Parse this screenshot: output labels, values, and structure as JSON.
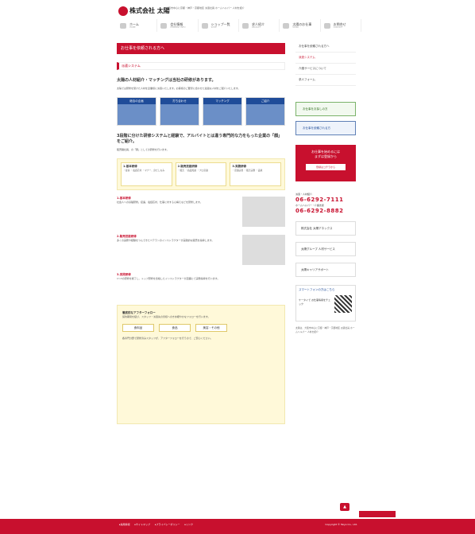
{
  "header": {
    "company": "株式会社 太陽",
    "tagline": "大阪市中心に京都・神戸・京都地区 派遣社員 ホームヘルパー 人材を紹介"
  },
  "nav": [
    {
      "jp": "ホーム",
      "en": "HOME"
    },
    {
      "jp": "会社情報",
      "en": "COMPANY INFO"
    },
    {
      "jp": "ショップ一覧",
      "en": "SHOP"
    },
    {
      "jp": "求人紹介",
      "en": "RECRUIT"
    },
    {
      "jp": "太陽のお仕事",
      "en": "WORK"
    },
    {
      "jp": "お問合せ",
      "en": "CONTACT"
    }
  ],
  "main": {
    "title": "お仕事を依頼される方へ",
    "section_label": "派遣システム",
    "h2a": "太陽の人材紹介・マッチングは当社の研修があります。",
    "intro": "太陽では研修を受けた人材を企業様に派遣いたします。お客様のご要望に合わせた最適な人材をご紹介いたします。",
    "flow": [
      "総合の企画",
      "打ち合わせ",
      "マッチング",
      "ご紹介"
    ],
    "h2b": "3段階に分けた研修システムと経験で、アルバイトとは違う専門的な力をもった企業の「顔」をご紹介。",
    "para2": "販売職社員、の「顔」としての研修を行います。",
    "training": [
      {
        "title": "1.基本研修",
        "items": "・接客 ・電話応対 ・マナー、身だしなみ"
      },
      {
        "title": "2.販売技能研修",
        "items": "・販売 ・商品知識 ・プロ意識"
      },
      {
        "title": "3.実務研修",
        "items": "・店舗実習 ・販売実務 ・品質"
      }
    ],
    "sec1_head": "1.基本研修",
    "sec1_text": "社会人への基礎研修。接遇、電話応対、仕事に対する心構えなどを研修します。",
    "sec2_head": "2.販売技能研修",
    "sec2_text": "多くの実務や経験をつんできたベテランのインストラクターが実践的な販売を指導します。",
    "sec3_head": "3.実践研修",
    "sec3_text": "1〜3の研修を終了し、トップ研修を合格したインストラクターが店舗にて実務指導を行います。",
    "follow_head": "徹底的なアフターフォロー",
    "follow_text": "契約期間を結び、スタッフ・派遣先の皆様へのきめ細やかなフォローを行います。",
    "tags": [
      "食料品",
      "食品",
      "美容・その他"
    ],
    "follow_end": "各専門分野で研修済みスタッフが、アフターフォローを行うので、ご安心ください。"
  },
  "side": {
    "nav": [
      "お仕事を依頼される方へ",
      "派遣システム",
      "介護サービスについて",
      "求人フォーム"
    ],
    "btn_green": "お仕事をお探しの方",
    "btn_blue": "お仕事を依頼される方",
    "cta_line1": "お仕事を始めるには",
    "cta_line2": "まずは登録から",
    "cta_btn": "登録はコチラから",
    "tel1_label": "派遣・人材紹介",
    "tel1": "06-6292-7111",
    "tel2_label": "ホームヘルパー・介護支援",
    "tel2": "06-6292-8882",
    "banner1": "株式会社 太陽アネックス",
    "banner2": "太陽グループ 人材サービス",
    "banner3": "太陽キャリアサポート",
    "mobile_head": "スマートフォンの方はこちら",
    "mobile_text": "ケータイで お仕事情報をチェック",
    "address": "太陽は、大阪市中心に京都・神戸・京都地区 派遣社員 ホームヘルパー 人材を紹介"
  },
  "footer": {
    "links": [
      "▸採用情報",
      "▸サイトマップ",
      "▸プライバシーポリシー",
      "▸リンク"
    ],
    "copyright": "Copyright © Taiyo Co., Ltd."
  }
}
